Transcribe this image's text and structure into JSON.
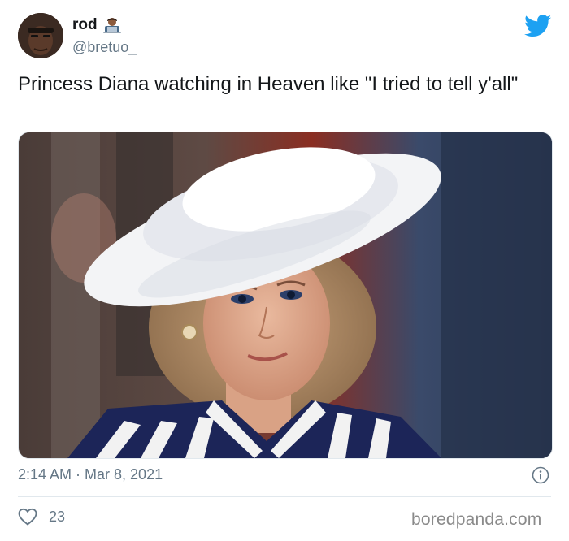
{
  "user": {
    "name": "rod",
    "handle": "@bretuo_",
    "emoji_icon": "technologist-emoji-icon"
  },
  "tweet": {
    "text": "Princess Diana watching in Heaven like \"I tried to tell y'all\"",
    "timestamp": "2:14 AM · Mar 8, 2021",
    "likes": "23"
  },
  "icons": {
    "platform": "twitter-bird-icon",
    "info": "info-icon",
    "like": "heart-icon"
  },
  "watermark": "boredpanda.com",
  "colors": {
    "twitter_blue": "#1DA1F2",
    "text": "#14171a",
    "secondary": "#657786"
  }
}
